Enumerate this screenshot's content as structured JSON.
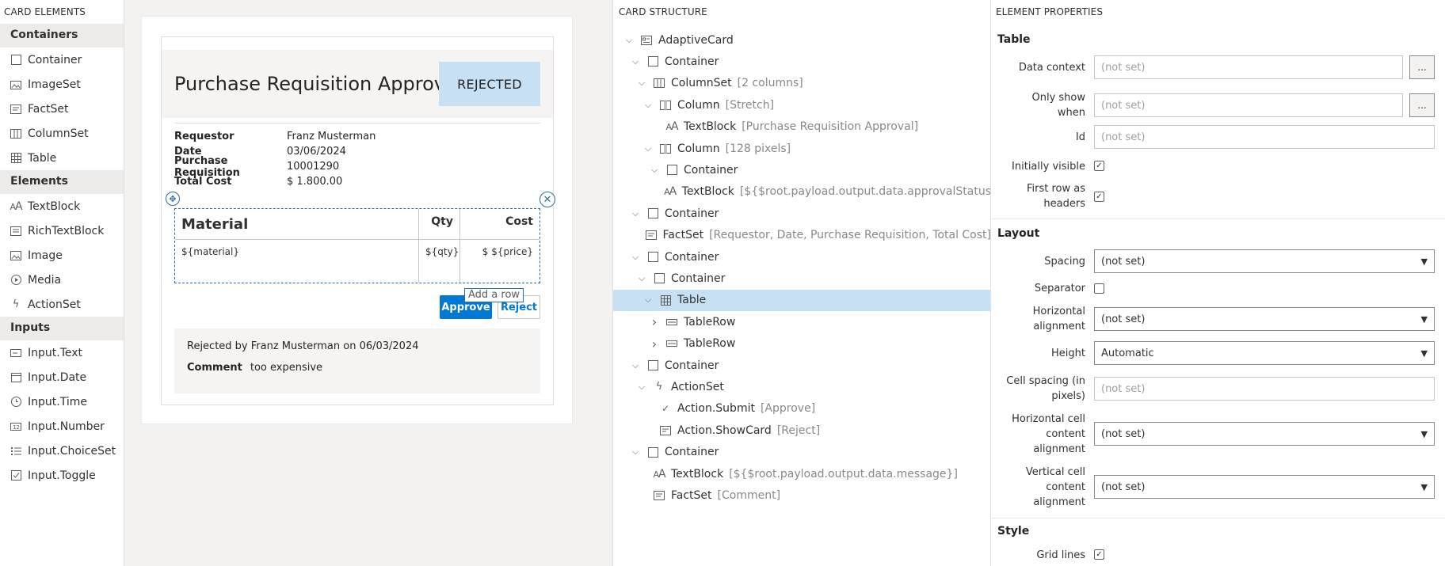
{
  "palette": {
    "title": "CARD ELEMENTS",
    "categories": [
      {
        "label": "Containers",
        "items": [
          {
            "label": "Container",
            "icon": "square-icon"
          },
          {
            "label": "ImageSet",
            "icon": "image-set-icon"
          },
          {
            "label": "FactSet",
            "icon": "fact-set-icon"
          },
          {
            "label": "ColumnSet",
            "icon": "column-set-icon"
          },
          {
            "label": "Table",
            "icon": "table-icon"
          }
        ]
      },
      {
        "label": "Elements",
        "items": [
          {
            "label": "TextBlock",
            "icon": "text-block-icon"
          },
          {
            "label": "RichTextBlock",
            "icon": "rich-text-icon"
          },
          {
            "label": "Image",
            "icon": "image-icon"
          },
          {
            "label": "Media",
            "icon": "media-icon"
          },
          {
            "label": "ActionSet",
            "icon": "lightning-icon"
          }
        ]
      },
      {
        "label": "Inputs",
        "items": [
          {
            "label": "Input.Text",
            "icon": "input-text-icon"
          },
          {
            "label": "Input.Date",
            "icon": "calendar-icon"
          },
          {
            "label": "Input.Time",
            "icon": "clock-icon"
          },
          {
            "label": "Input.Number",
            "icon": "number-icon"
          },
          {
            "label": "Input.ChoiceSet",
            "icon": "list-icon"
          },
          {
            "label": "Input.Toggle",
            "icon": "checkbox-icon"
          }
        ]
      }
    ]
  },
  "card": {
    "title": "Purchase Requisition Approval",
    "status": "REJECTED",
    "facts": [
      {
        "key": "Requestor",
        "value": "Franz Musterman"
      },
      {
        "key": "Date",
        "value": "03/06/2024"
      },
      {
        "key": "Purchase Requisition",
        "value": "10001290"
      },
      {
        "key": "Total Cost",
        "value": "$ 1.800.00"
      }
    ],
    "table": {
      "headers": [
        "Material",
        "Qty",
        "Cost"
      ],
      "row": [
        "${material}",
        "${qty}",
        "$ ${price}"
      ]
    },
    "add_row_label": "Add a row",
    "approve_label": "Approve",
    "reject_label": "Reject",
    "footer_message": "Rejected by Franz Musterman on 06/03/2024",
    "comment_key": "Comment",
    "comment_value": "too expensive"
  },
  "tree": {
    "title": "CARD STRUCTURE",
    "nodes": [
      {
        "label": "AdaptiveCard",
        "desc": "",
        "chev": "down",
        "icon": "card-icon",
        "depth": 0
      },
      {
        "label": "Container",
        "desc": "",
        "chev": "down",
        "icon": "square-icon",
        "depth": 1
      },
      {
        "label": "ColumnSet",
        "desc": "[2 columns]",
        "chev": "down",
        "icon": "column-set-icon",
        "depth": 2
      },
      {
        "label": "Column",
        "desc": "[Stretch]",
        "chev": "down",
        "icon": "column-icon",
        "depth": 3
      },
      {
        "label": "TextBlock",
        "desc": "[Purchase Requisition Approval]",
        "chev": "",
        "icon": "text-block-icon",
        "depth": 4
      },
      {
        "label": "Column",
        "desc": "[128 pixels]",
        "chev": "down",
        "icon": "column-icon",
        "depth": 3
      },
      {
        "label": "Container",
        "desc": "",
        "chev": "down",
        "icon": "square-icon",
        "depth": 4
      },
      {
        "label": "TextBlock",
        "desc": "[${$root.payload.output.data.approvalStatus",
        "chev": "",
        "icon": "text-block-icon",
        "depth": 5
      },
      {
        "label": "Container",
        "desc": "",
        "chev": "down",
        "icon": "square-icon",
        "depth": 1
      },
      {
        "label": "FactSet",
        "desc": "[Requestor, Date, Purchase Requisition, Total Cost]",
        "chev": "",
        "icon": "fact-set-icon",
        "depth": 2
      },
      {
        "label": "Container",
        "desc": "",
        "chev": "down",
        "icon": "square-icon",
        "depth": 1
      },
      {
        "label": "Container",
        "desc": "",
        "chev": "down",
        "icon": "square-icon",
        "depth": 2
      },
      {
        "label": "Table",
        "desc": "",
        "chev": "down",
        "icon": "table-icon",
        "depth": 3,
        "selected": true
      },
      {
        "label": "TableRow",
        "desc": "",
        "chev": "right",
        "icon": "table-row-icon",
        "depth": 4
      },
      {
        "label": "TableRow",
        "desc": "",
        "chev": "right",
        "icon": "table-row-icon",
        "depth": 4
      },
      {
        "label": "Container",
        "desc": "",
        "chev": "down",
        "icon": "square-icon",
        "depth": 1
      },
      {
        "label": "ActionSet",
        "desc": "",
        "chev": "down",
        "icon": "lightning-icon",
        "depth": 2
      },
      {
        "label": "Action.Submit",
        "desc": "[Approve]",
        "chev": "",
        "icon": "check-icon",
        "depth": 3
      },
      {
        "label": "Action.ShowCard",
        "desc": "[Reject]",
        "chev": "",
        "icon": "show-card-icon",
        "depth": 3
      },
      {
        "label": "Container",
        "desc": "",
        "chev": "down",
        "icon": "square-icon",
        "depth": 1
      },
      {
        "label": "TextBlock",
        "desc": "[${$root.payload.output.data.message}]",
        "chev": "",
        "icon": "text-block-icon",
        "depth": 2
      },
      {
        "label": "FactSet",
        "desc": "[Comment]",
        "chev": "",
        "icon": "fact-set-icon",
        "depth": 2
      }
    ]
  },
  "props": {
    "title": "ELEMENT PROPERTIES",
    "section_table": "Table",
    "data_context_label": "Data context",
    "data_context_placeholder": "(not set)",
    "only_show_when_label": "Only show when",
    "only_show_when_placeholder": "(not set)",
    "id_label": "Id",
    "id_placeholder": "(not set)",
    "initially_visible_label": "Initially visible",
    "first_row_headers_label": "First row as headers",
    "ellipsis": "...",
    "section_layout": "Layout",
    "spacing_label": "Spacing",
    "spacing_value": "(not set)",
    "separator_label": "Separator",
    "h_align_label": "Horizontal alignment",
    "h_align_value": "(not set)",
    "height_label": "Height",
    "height_value": "Automatic",
    "cell_spacing_label": "Cell spacing (in pixels)",
    "cell_spacing_placeholder": "(not set)",
    "h_cell_align_label": "Horizontal cell content alignment",
    "h_cell_align_value": "(not set)",
    "v_cell_align_label": "Vertical cell content alignment",
    "v_cell_align_value": "(not set)",
    "section_style": "Style",
    "grid_lines_label": "Grid lines"
  },
  "colors": {
    "accent": "#0078d4",
    "selection": "#c7e0f4",
    "status_bg": "#c7e0f4"
  }
}
